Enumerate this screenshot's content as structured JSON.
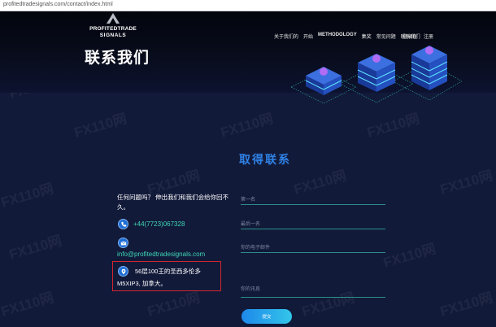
{
  "browser": {
    "url": "profitedtradesignals.com/contact/index.html"
  },
  "brand": {
    "line1": "PROFITEDTRADE",
    "line2": "SIGNALS"
  },
  "nav": {
    "items": [
      {
        "label": "关于我们的"
      },
      {
        "label": "开始"
      },
      {
        "label": "METHODOLOGY"
      },
      {
        "label": "集奖"
      },
      {
        "label": "常见问题"
      },
      {
        "label": "联系我们"
      }
    ],
    "login": "登录在",
    "register": "注册"
  },
  "page": {
    "title": "联系我们"
  },
  "contact": {
    "heading": "取得联系",
    "intro": "任何问题吗？ 伸出我们和我们会给你回不久。",
    "phone": "+44(7723)067328",
    "email": "info@profitedtradesignals.com",
    "address": "56层100王的圣西多伦多 M5XIP3, 加拿大。"
  },
  "form": {
    "first_name": {
      "placeholder": "第一名",
      "value": ""
    },
    "last_name": {
      "placeholder": "最后一名",
      "value": ""
    },
    "email": {
      "placeholder": "你的电子邮件",
      "value": ""
    },
    "message": {
      "placeholder": "你的讯息",
      "value": ""
    },
    "submit_label": "提交"
  },
  "watermark": {
    "text": "FX110网"
  },
  "colors": {
    "background": "#121a3a",
    "heading_blue": "#2f82e6",
    "link_teal": "#3fd6b5",
    "icon_blue": "#1f6fd6",
    "highlight_red": "#d2262d"
  },
  "icons": {
    "phone": "phone-icon",
    "email": "envelope-icon",
    "address": "location-pin-icon"
  }
}
